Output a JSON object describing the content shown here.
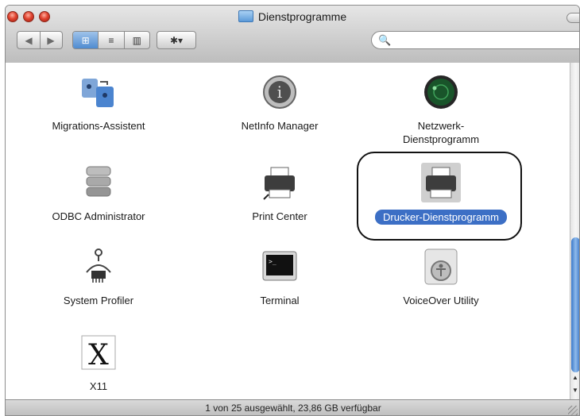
{
  "window": {
    "title": "Dienstprogramme",
    "search": {
      "placeholder": "",
      "value": ""
    },
    "toolbar": {
      "back": "◀",
      "forward": "▶",
      "view_icon": "⊞",
      "view_list": "≡",
      "view_columns": "▥",
      "action": "✱▾",
      "search_icon": "🔍"
    }
  },
  "items": [
    {
      "label": "Migrations-Assistent",
      "icon": "migration-assistant-icon"
    },
    {
      "label": "NetInfo Manager",
      "icon": "netinfo-manager-icon"
    },
    {
      "label": "Netzwerk-\nDienstprogramm",
      "icon": "network-utility-icon"
    },
    {
      "label": "ODBC Administrator",
      "icon": "database-icon"
    },
    {
      "label": "Print Center",
      "icon": "printer-icon"
    },
    {
      "label": "Drucker-Dienstprogramm",
      "icon": "printer-utility-icon",
      "selected": true
    },
    {
      "label": "System Profiler",
      "icon": "system-profiler-icon"
    },
    {
      "label": "Terminal",
      "icon": "terminal-icon"
    },
    {
      "label": "VoiceOver Utility",
      "icon": "voiceover-utility-icon"
    },
    {
      "label": "X11",
      "icon": "x11-icon"
    }
  ],
  "statusbar": {
    "text": "1 von 25 ausgewählt, 23,86 GB verfügbar"
  }
}
